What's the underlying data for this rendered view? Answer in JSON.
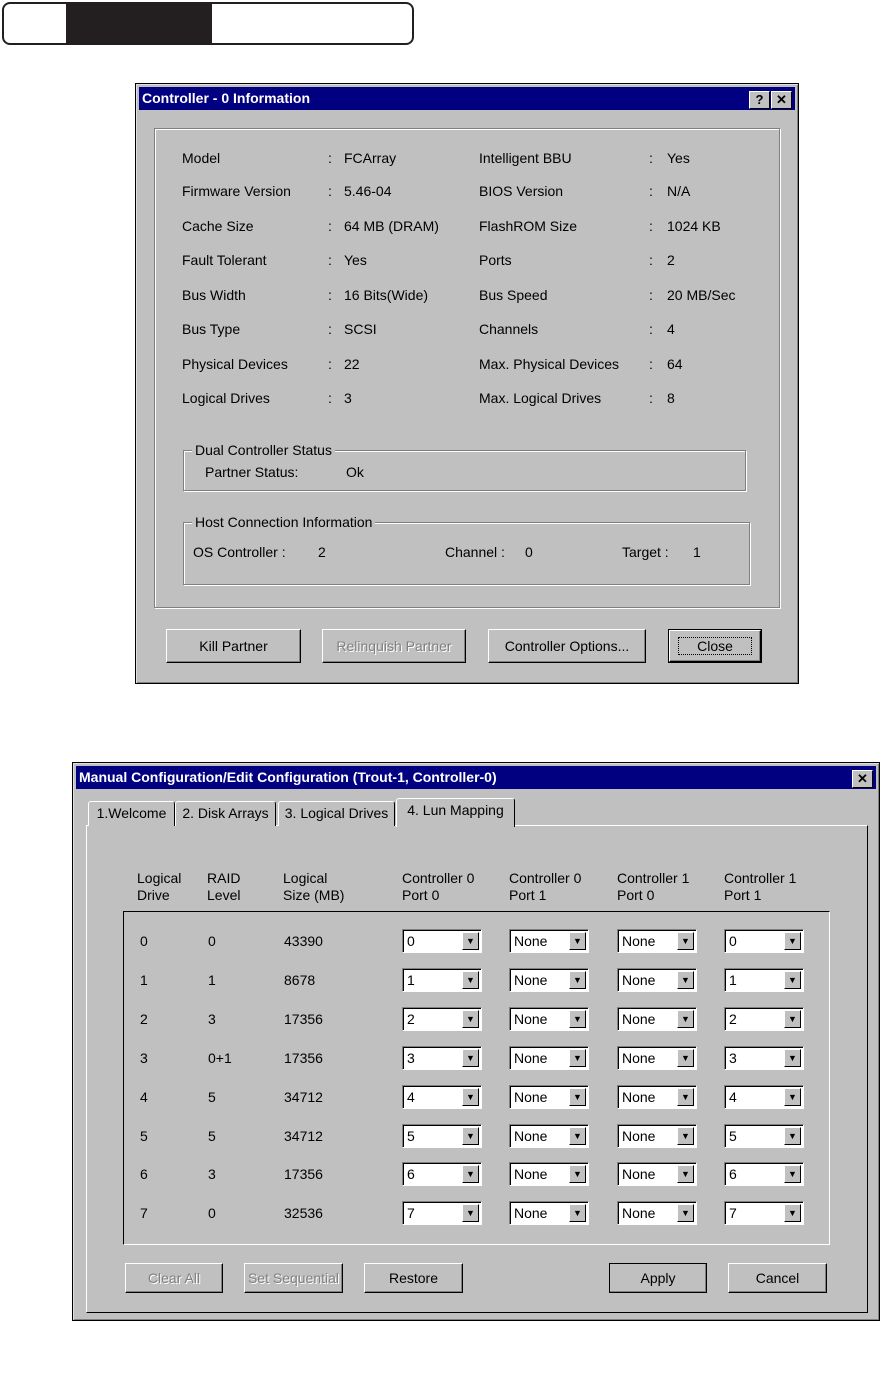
{
  "controller_dialog": {
    "title": "Controller - 0 Information",
    "help_label": "?",
    "close_icon_label": "✕",
    "left": [
      [
        "Model",
        "FCArray"
      ],
      [
        "Firmware Version",
        "5.46-04"
      ],
      [
        "Cache Size",
        "64 MB (DRAM)"
      ],
      [
        "Fault Tolerant",
        "Yes"
      ],
      [
        "Bus Width",
        "16 Bits(Wide)"
      ],
      [
        "Bus Type",
        "SCSI"
      ],
      [
        "Physical Devices",
        "22"
      ],
      [
        "Logical Drives",
        "3"
      ]
    ],
    "right": [
      [
        "Intelligent BBU",
        "Yes"
      ],
      [
        "BIOS Version",
        "N/A"
      ],
      [
        "FlashROM Size",
        "1024 KB"
      ],
      [
        "Ports",
        "2"
      ],
      [
        "Bus Speed",
        "20 MB/Sec"
      ],
      [
        "Channels",
        "4"
      ],
      [
        "Max. Physical Devices",
        "64"
      ],
      [
        "Max. Logical Drives",
        "8"
      ]
    ],
    "separator": ":",
    "dual": {
      "legend": "Dual Controller Status",
      "label": "Partner  Status:",
      "value": "Ok"
    },
    "host": {
      "legend": "Host Connection Information",
      "os_label": "OS Controller :",
      "os_value": "2",
      "ch_label": "Channel :",
      "ch_value": "0",
      "tg_label": "Target :",
      "tg_value": "1"
    },
    "buttons": {
      "kill": "Kill Partner",
      "relinquish": "Relinquish Partner",
      "options": "Controller Options...",
      "close": "Close"
    }
  },
  "config_dialog": {
    "title": "Manual Configuration/Edit Configuration (Trout-1, Controller-0)",
    "close_icon_label": "✕",
    "tabs": [
      "1.Welcome",
      "2. Disk Arrays",
      "3. Logical Drives",
      "4. Lun Mapping"
    ],
    "active_tab": 3,
    "headers": [
      [
        "Logical",
        "Drive"
      ],
      [
        "RAID",
        "Level"
      ],
      [
        "Logical",
        "Size (MB)"
      ],
      [
        "Controller 0",
        "Port 0"
      ],
      [
        "Controller 0",
        "Port 1"
      ],
      [
        "Controller 1",
        "Port 0"
      ],
      [
        "Controller 1",
        "Port 1"
      ]
    ],
    "rows": [
      [
        "0",
        "0",
        "43390",
        "0",
        "None",
        "None",
        "0"
      ],
      [
        "1",
        "1",
        "8678",
        "1",
        "None",
        "None",
        "1"
      ],
      [
        "2",
        "3",
        "17356",
        "2",
        "None",
        "None",
        "2"
      ],
      [
        "3",
        "0+1",
        "17356",
        "3",
        "None",
        "None",
        "3"
      ],
      [
        "4",
        "5",
        "34712",
        "4",
        "None",
        "None",
        "4"
      ],
      [
        "5",
        "5",
        "34712",
        "5",
        "None",
        "None",
        "5"
      ],
      [
        "6",
        "3",
        "17356",
        "6",
        "None",
        "None",
        "6"
      ],
      [
        "7",
        "0",
        "32536",
        "7",
        "None",
        "None",
        "7"
      ]
    ],
    "buttons": {
      "clear": "Clear All",
      "sequential": "Set Sequential",
      "restore": "Restore",
      "apply": "Apply",
      "cancel": "Cancel"
    }
  }
}
